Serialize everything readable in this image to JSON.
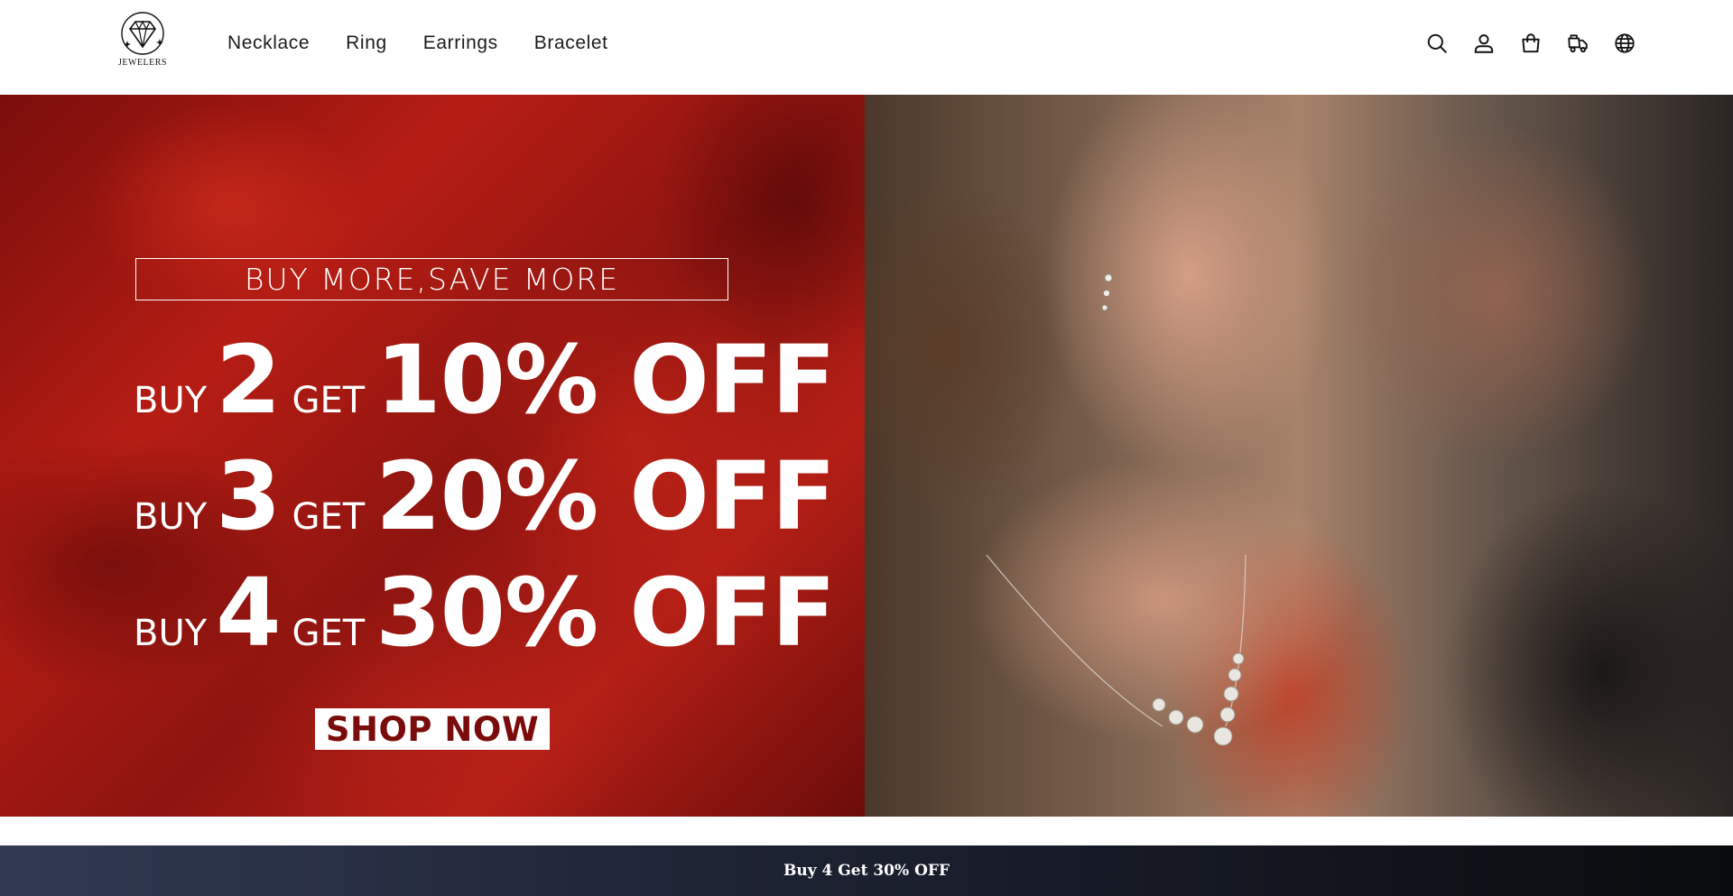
{
  "brand": {
    "logo_text": "JEWELERS"
  },
  "nav": {
    "items": [
      {
        "label": "Necklace"
      },
      {
        "label": "Ring"
      },
      {
        "label": "Earrings"
      },
      {
        "label": "Bracelet"
      }
    ]
  },
  "header_icons": [
    "search-icon",
    "account-icon",
    "cart-icon",
    "order-tracking-icon",
    "language-icon"
  ],
  "hero": {
    "tagline": "BUY MORE,SAVE MORE",
    "offers": [
      {
        "buy": "BUY",
        "qty": "2",
        "get": "GET",
        "discount": "10% OFF"
      },
      {
        "buy": "BUY",
        "qty": "3",
        "get": "GET",
        "discount": "20% OFF"
      },
      {
        "buy": "BUY",
        "qty": "4",
        "get": "GET",
        "discount": "30% OFF"
      }
    ],
    "cta_label": "SHOP NOW",
    "colors": {
      "promo_red": "#b51d14",
      "cta_text": "#7a0d0b"
    }
  },
  "announcement": {
    "text": "Buy 4 Get 30% OFF"
  }
}
